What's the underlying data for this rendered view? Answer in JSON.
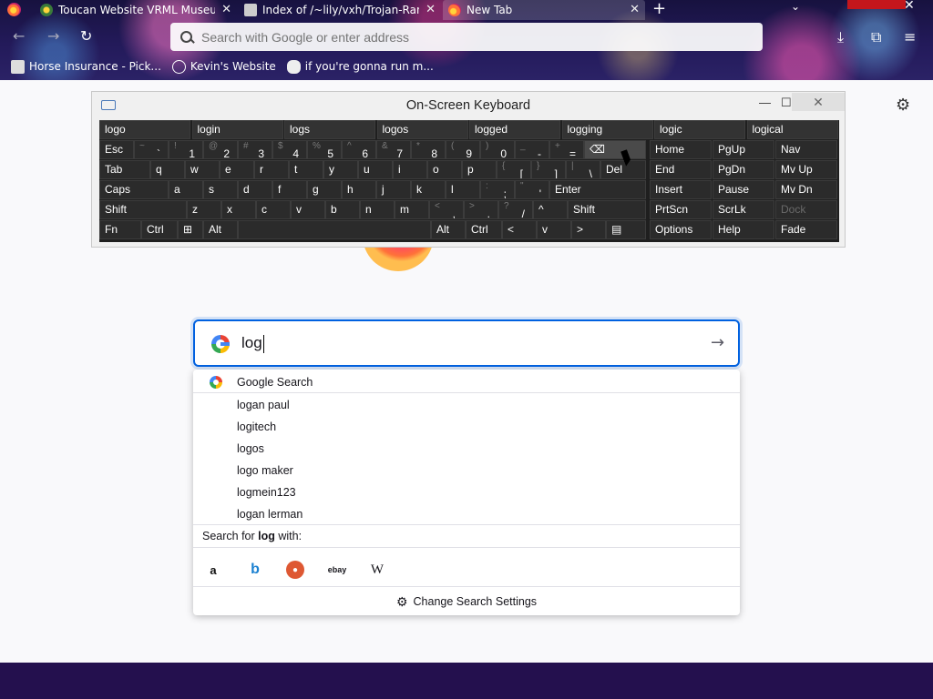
{
  "browser": {
    "tabs": [
      {
        "title": "Toucan Website VRML Museum",
        "active": false
      },
      {
        "title": "Index of /~lily/vxh/Trojan-Ran...",
        "active": false
      },
      {
        "title": "New Tab",
        "active": true
      }
    ],
    "urlbar_placeholder": "Search with Google or enter address",
    "bookmarks": [
      "Horse Insurance - Pick...",
      "Kevin's Website",
      "if you're gonna run m..."
    ]
  },
  "osk": {
    "title": "On-Screen Keyboard",
    "predictions": [
      "logo",
      "login",
      "logs",
      "logos",
      "logged",
      "logging",
      "logic",
      "logical"
    ],
    "row1": [
      {
        "main": "Esc"
      },
      {
        "shift": "~",
        "main": "`"
      },
      {
        "shift": "!",
        "main": "1"
      },
      {
        "shift": "@",
        "main": "2"
      },
      {
        "shift": "#",
        "main": "3"
      },
      {
        "shift": "$",
        "main": "4"
      },
      {
        "shift": "%",
        "main": "5"
      },
      {
        "shift": "^",
        "main": "6"
      },
      {
        "shift": "&",
        "main": "7"
      },
      {
        "shift": "*",
        "main": "8"
      },
      {
        "shift": "(",
        "main": "9"
      },
      {
        "shift": ")",
        "main": "0"
      },
      {
        "shift": "_",
        "main": "-"
      },
      {
        "shift": "+",
        "main": "="
      },
      {
        "main": "⌫"
      }
    ],
    "row2": [
      "Tab",
      "q",
      "w",
      "e",
      "r",
      "t",
      "y",
      "u",
      "i",
      "o",
      "p"
    ],
    "row2_brackets": [
      {
        "shift": "{",
        "main": "["
      },
      {
        "shift": "}",
        "main": "]"
      },
      {
        "shift": "|",
        "main": "\\"
      }
    ],
    "row2_end": "Del",
    "row3": [
      "Caps",
      "a",
      "s",
      "d",
      "f",
      "g",
      "h",
      "j",
      "k",
      "l"
    ],
    "row3_punct": [
      {
        "shift": ":",
        "main": ";"
      },
      {
        "shift": "\"",
        "main": "'"
      }
    ],
    "row3_end": "Enter",
    "row4": [
      "Shift",
      "z",
      "x",
      "c",
      "v",
      "b",
      "n",
      "m"
    ],
    "row4_punct": [
      {
        "shift": "<",
        "main": ","
      },
      {
        "shift": ">",
        "main": "."
      },
      {
        "shift": "?",
        "main": "/"
      }
    ],
    "row4_up": "^",
    "row4_end": "Shift",
    "row5": {
      "fn": "Fn",
      "ctrl": "Ctrl",
      "alt": "Alt",
      "alt_r": "Alt",
      "ctrl_r": "Ctrl",
      "left": "<",
      "down": "v",
      "right": ">"
    },
    "nav": [
      [
        "Home",
        "PgUp",
        "Nav"
      ],
      [
        "End",
        "PgDn",
        "Mv Up"
      ],
      [
        "Insert",
        "Pause",
        "Mv Dn"
      ],
      [
        "PrtScn",
        "ScrLk",
        "Dock"
      ],
      [
        "Options",
        "Help",
        "Fade"
      ]
    ]
  },
  "search": {
    "query": "log",
    "google_label": "Google Search",
    "suggestions": [
      "logan paul",
      "logitech",
      "logos",
      "logo maker",
      "logmein123",
      "logan lerman"
    ],
    "search_for_prefix": "Search for ",
    "search_for_term": "log",
    "search_for_suffix": " with:",
    "engines": [
      "amazon",
      "bing",
      "duckduckgo",
      "ebay",
      "wikipedia"
    ],
    "change_settings": "Change Search Settings"
  },
  "icons": {
    "amazon": "a",
    "bing": "b",
    "ebay": "ebay",
    "wiki": "W"
  }
}
